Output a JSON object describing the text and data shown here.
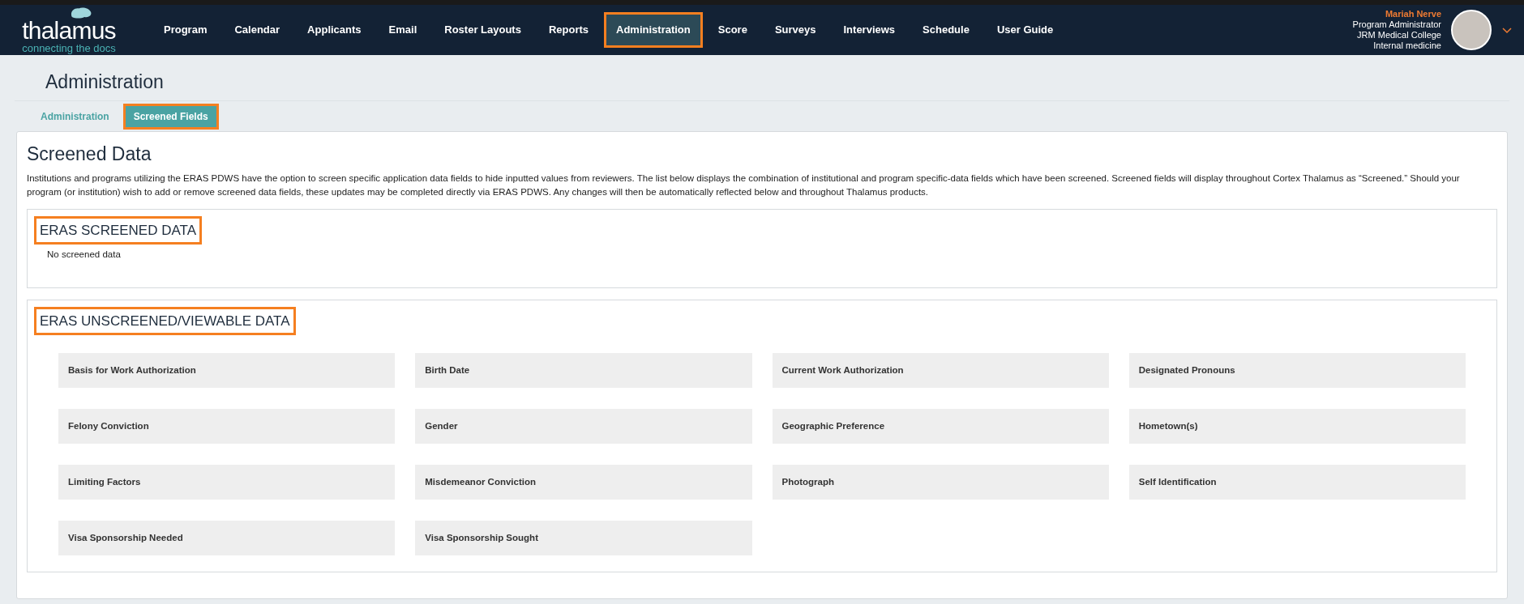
{
  "header": {
    "logo": {
      "name": "thalamus",
      "tagline": "connecting the docs"
    },
    "nav": [
      {
        "label": "Program",
        "selected": false,
        "highlighted": false
      },
      {
        "label": "Calendar",
        "selected": false,
        "highlighted": false
      },
      {
        "label": "Applicants",
        "selected": false,
        "highlighted": false
      },
      {
        "label": "Email",
        "selected": false,
        "highlighted": false
      },
      {
        "label": "Roster Layouts",
        "selected": false,
        "highlighted": false
      },
      {
        "label": "Reports",
        "selected": false,
        "highlighted": false
      },
      {
        "label": "Administration",
        "selected": true,
        "highlighted": true
      },
      {
        "label": "Score",
        "selected": false,
        "highlighted": false
      },
      {
        "label": "Surveys",
        "selected": false,
        "highlighted": false
      },
      {
        "label": "Interviews",
        "selected": false,
        "highlighted": false
      },
      {
        "label": "Schedule",
        "selected": false,
        "highlighted": false
      },
      {
        "label": "User Guide",
        "selected": false,
        "highlighted": false
      }
    ],
    "user": {
      "name": "Mariah Nerve",
      "role": "Program Administrator",
      "institution": "JRM Medical College",
      "program": "Internal medicine"
    }
  },
  "page_title": "Administration",
  "tabs": [
    {
      "label": "Administration",
      "selected": false,
      "highlighted": false
    },
    {
      "label": "Screened Fields",
      "selected": true,
      "highlighted": true
    }
  ],
  "card": {
    "title": "Screened Data",
    "description": "Institutions and programs utilizing the ERAS PDWS have the option to screen specific application data fields to hide inputted values from reviewers. The list below displays the combination of institutional and program specific-data fields which have been screened. Screened fields will display throughout Cortex Thalamus as “Screened.” Should your program (or institution) wish to add or remove screened data fields, these updates may be completed directly via ERAS PDWS. Any changes will then be automatically reflected below and throughout Thalamus products.",
    "sections": [
      {
        "heading": "ERAS SCREENED DATA",
        "highlighted": true,
        "empty_text": "No screened data"
      },
      {
        "heading": "ERAS UNSCREENED/VIEWABLE DATA",
        "highlighted": true,
        "fields": [
          "Basis for Work Authorization",
          "Birth Date",
          "Current Work Authorization",
          "Designated Pronouns",
          "Felony Conviction",
          "Gender",
          "Geographic Preference",
          "Hometown(s)",
          "Limiting Factors",
          "Misdemeanor Conviction",
          "Photograph",
          "Self Identification",
          "Visa Sponsorship Needed",
          "Visa Sponsorship Sought"
        ]
      }
    ]
  }
}
